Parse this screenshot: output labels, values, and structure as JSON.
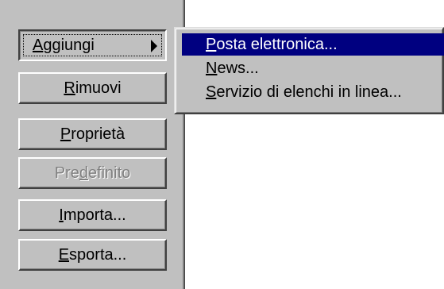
{
  "buttons": {
    "aggiungi": {
      "pre": "",
      "key": "A",
      "post": "ggiungi"
    },
    "rimuovi": {
      "pre": "",
      "key": "R",
      "post": "imuovi"
    },
    "proprieta": {
      "pre": "",
      "key": "P",
      "post": "roprietà"
    },
    "predefinito": {
      "pre": "Pre",
      "key": "d",
      "post": "efinito"
    },
    "importa": {
      "pre": "",
      "key": "I",
      "post": "mporta..."
    },
    "esporta": {
      "pre": "",
      "key": "E",
      "post": "sporta..."
    }
  },
  "submenu": {
    "items": [
      {
        "key": "P",
        "post": "osta elettronica..."
      },
      {
        "key": "N",
        "post": "ews..."
      },
      {
        "key": "S",
        "post": "ervizio di elenchi in linea..."
      }
    ]
  },
  "icons": {
    "submenu_arrow": "triangle-right-icon"
  },
  "colors": {
    "face": "#c0c0c0",
    "highlight": "#000080",
    "highlight_text": "#ffffff",
    "disabled_text": "#808080"
  }
}
